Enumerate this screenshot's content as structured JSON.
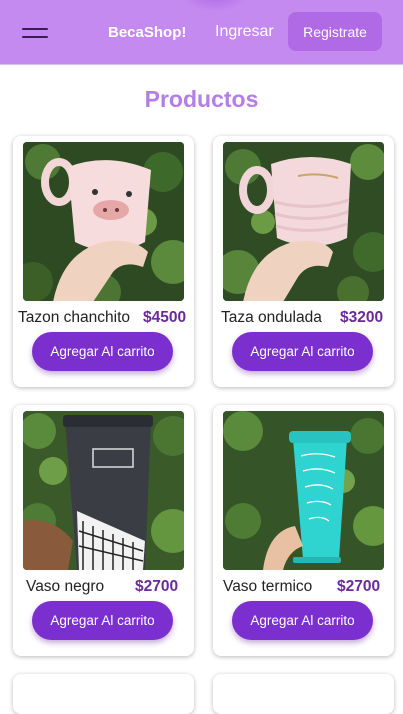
{
  "navbar": {
    "brand": "BecaShop!",
    "login_label": "Ingresar",
    "register_label": "Registrate",
    "menu_icon": "hamburger-menu-icon",
    "background_color": "#c58af0"
  },
  "section": {
    "title": "Productos"
  },
  "products": [
    {
      "name": "Tazon chanchito",
      "price": "$4500",
      "button_label": "Agregar Al carrito",
      "image": "pig-mug-photo"
    },
    {
      "name": "Taza ondulada",
      "price": "$3200",
      "button_label": "Agregar Al carrito",
      "image": "wavy-cup-photo"
    },
    {
      "name": "Vaso negro",
      "price": "$2700",
      "button_label": "Agregar Al carrito",
      "image": "black-tumbler-photo"
    },
    {
      "name": "Vaso termico",
      "price": "$2700",
      "button_label": "Agregar Al carrito",
      "image": "thermal-cup-photo"
    }
  ],
  "colors": {
    "accent": "#7b2fce",
    "price": "#6a2a9a",
    "title": "#b57ee6"
  }
}
